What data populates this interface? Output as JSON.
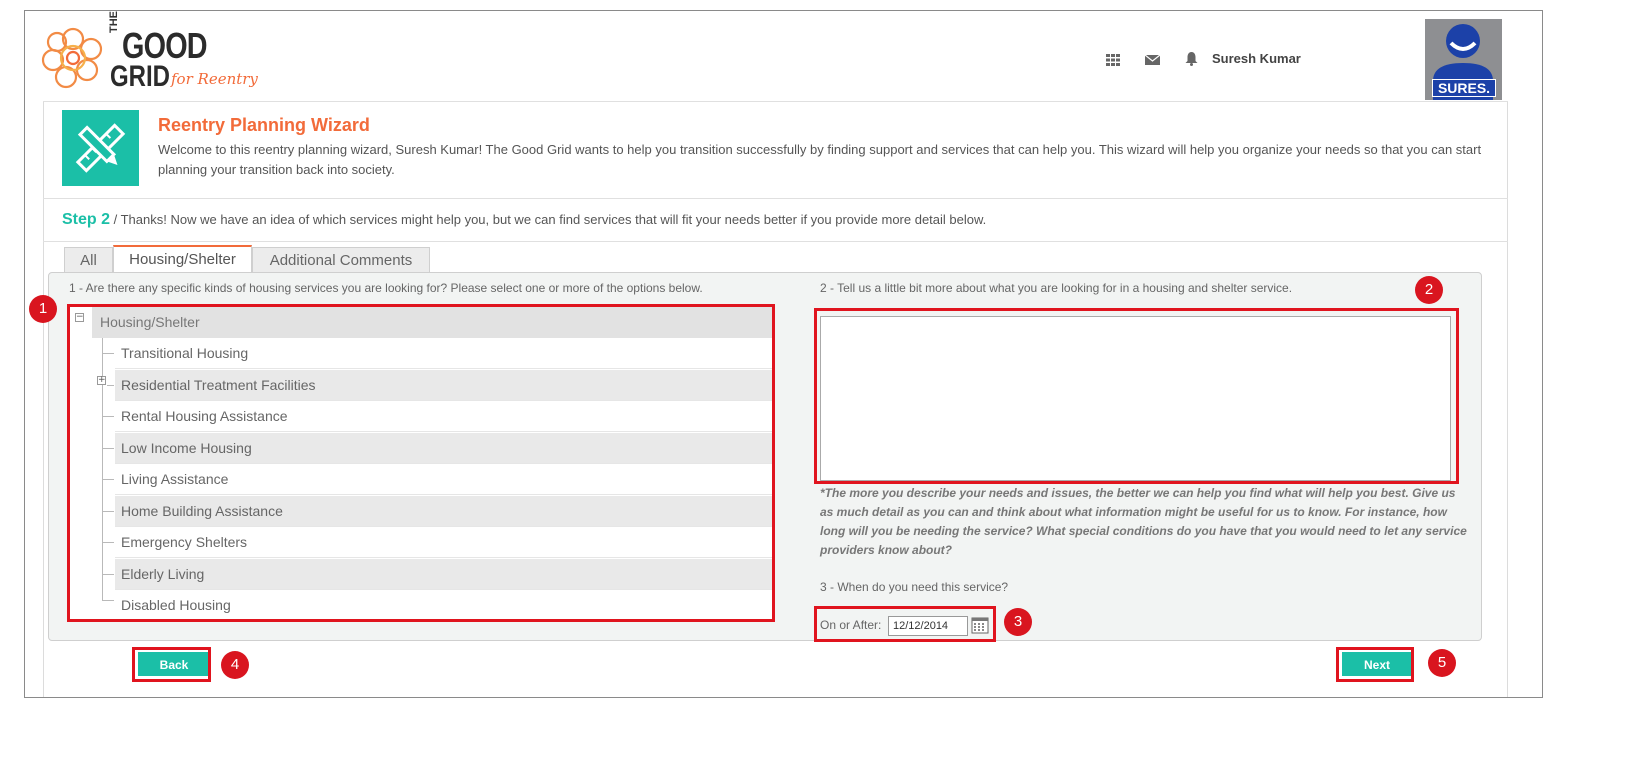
{
  "header": {
    "logo": {
      "the": "THE",
      "good": "GOOD",
      "grid": "GRID",
      "tagline": "for Reentry"
    },
    "icons": [
      "apps-grid-icon",
      "mail-icon",
      "bell-icon"
    ],
    "user_name": "Suresh Kumar",
    "avatar_label": "SURES."
  },
  "wizard": {
    "title": "Reentry Planning Wizard",
    "description": "Welcome to this reentry planning wizard, Suresh Kumar! The Good Grid wants to help you transition successfully by finding support and services that can help you. This wizard will help you organize your needs so that you can start planning your transition back into society.",
    "step_label": "Step 2",
    "step_text": " / Thanks! Now we have an idea of which services might help you, but we can find services that will fit your needs better if you provide more detail below."
  },
  "tabs": [
    {
      "label": "All",
      "active": false
    },
    {
      "label": "Housing/Shelter",
      "active": true
    },
    {
      "label": "Additional Comments",
      "active": false
    }
  ],
  "question1": "1 - Are there any specific kinds of housing services you are looking for? Please select one or more of the options below.",
  "tree": {
    "root": "Housing/Shelter",
    "items": [
      "Transitional Housing",
      "Residential Treatment Facilities",
      "Rental Housing Assistance",
      "Low Income Housing",
      "Living Assistance",
      "Home Building Assistance",
      "Emergency Shelters",
      "Elderly Living",
      "Disabled Housing"
    ]
  },
  "question2": "2 - Tell us a little bit more about what you are looking for in a housing and shelter service.",
  "description_value": "",
  "hint": "*The more you describe your needs and issues, the better we can help you find what will help you best. Give us as much detail as you can and think about what information might be useful for us to know. For instance, how long will you be needing the service? What special conditions do you have that you would need to let any service providers know about?",
  "question3": "3 - When do you need this service?",
  "date_label": "On or After:",
  "date_value": "12/12/2014",
  "buttons": {
    "back": "Back",
    "next": "Next"
  },
  "callouts": [
    "1",
    "2",
    "3",
    "4",
    "5"
  ],
  "colors": {
    "accent": "#1bbfa7",
    "brand_orange": "#f26b3a",
    "callout_red": "#e0141e"
  }
}
